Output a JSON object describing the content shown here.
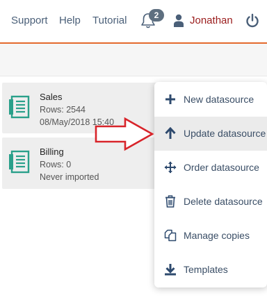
{
  "nav": {
    "support": "Support",
    "help": "Help",
    "tutorial": "Tutorial",
    "notifications_count": "2",
    "user_name": "Jonathan"
  },
  "datasources": [
    {
      "name": "Sales",
      "rows": "Rows: 2544",
      "status": "08/May/2018 15:40"
    },
    {
      "name": "Billing",
      "rows": "Rows: 0",
      "status": "Never imported"
    }
  ],
  "menu": {
    "items": [
      {
        "label": "New datasource",
        "icon": "plus-icon"
      },
      {
        "label": "Update datasource",
        "icon": "arrow-up-icon",
        "active": true
      },
      {
        "label": "Order datasource",
        "icon": "move-arrows-icon"
      },
      {
        "label": "Delete datasource",
        "icon": "trash-icon"
      },
      {
        "label": "Manage copies",
        "icon": "copy-icon"
      },
      {
        "label": "Templates",
        "icon": "download-icon"
      }
    ]
  },
  "colors": {
    "accent_line": "#e4692c",
    "user_name": "#9a1c1c",
    "card_icon": "#2aa08a",
    "annotation_arrow": "#d8242a",
    "menu_text": "#3a4e66"
  }
}
